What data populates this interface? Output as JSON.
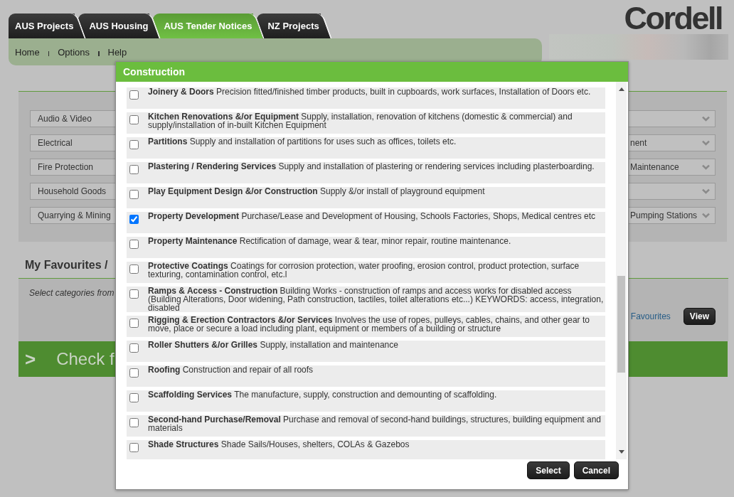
{
  "header": {
    "tabs": [
      {
        "label": "AUS Projects",
        "selected": false
      },
      {
        "label": "AUS Housing",
        "selected": false
      },
      {
        "label": "AUS Tender Notices",
        "selected": true
      },
      {
        "label": "NZ Projects",
        "selected": false
      }
    ],
    "logo": "Cordell"
  },
  "nav": {
    "links": [
      "Home",
      "Options",
      "Help"
    ]
  },
  "category_dropdowns": [
    {
      "left": "Audio & Video"
    },
    {
      "left": "Electrical",
      "right": "nent"
    },
    {
      "left": "Fire Protection",
      "right": "Maintenance"
    },
    {
      "left": "Household Goods"
    },
    {
      "left": "Quarrying & Mining",
      "right": "Pumping Stations"
    }
  ],
  "favourites": {
    "title": "My Favourites /",
    "hint": "Select categories from",
    "link": "Favourites",
    "button": "View"
  },
  "banner": {
    "arrow": ">",
    "text": "Check f"
  },
  "dialog": {
    "title": "Construction",
    "items": [
      {
        "name": "Joinery & Doors",
        "description": "Precision fitted/finished timber products, built in cupboards, work surfaces, Installation of Doors etc.",
        "checked": false
      },
      {
        "name": "Kitchen Renovations &/or Equipment",
        "description": "Supply, installation, renovation of kitchens (domestic & commercial) and supply/installation of in-built Kitchen Equipment",
        "checked": false
      },
      {
        "name": "Partitions",
        "description": "Supply and installation of partitions for uses such as offices, toilets etc.",
        "checked": false
      },
      {
        "name": "Plastering / Rendering Services",
        "description": "Supply and installation of plastering or rendering services including plasterboarding.",
        "checked": false
      },
      {
        "name": "Play Equipment Design &/or Construction",
        "description": "Supply &/or install of playground equipment",
        "checked": false
      },
      {
        "name": "Property Development",
        "description": "Purchase/Lease and Development of Housing, Schools Factories, Shops, Medical centres etc",
        "checked": true
      },
      {
        "name": "Property Maintenance",
        "description": "Rectification of damage, wear & tear, minor repair, routine maintenance.",
        "checked": false
      },
      {
        "name": "Protective Coatings",
        "description": "Coatings for corrosion protection, water proofing, erosion control, product protection, surface texturing, contamination control, etc.l",
        "checked": false
      },
      {
        "name": "Ramps & Access - Construction",
        "description": "Building Works - construction of ramps and access works for disabled access (Building Alterations, Door widening, Path construction, tactiles, toilet alterations etc...) KEYWORDS: access, integration, disabled",
        "checked": false
      },
      {
        "name": "Rigging & Erection Contractors &/or Services",
        "description": "Involves the use of ropes, pulleys, cables, chains, and other gear to move, place or secure a load including plant, equipment or members of a building or structure",
        "checked": false
      },
      {
        "name": "Roller Shutters &/or Grilles",
        "description": "Supply, installation and maintenance",
        "checked": false
      },
      {
        "name": "Roofing",
        "description": "Construction and repair of all roofs",
        "checked": false
      },
      {
        "name": "Scaffolding Services",
        "description": "The manufacture, supply, construction and demounting of scaffolding.",
        "checked": false
      },
      {
        "name": "Second-hand Purchase/Removal",
        "description": "Purchase and removal of second-hand buildings, structures, building equipment and materials",
        "checked": false
      },
      {
        "name": "Shade Structures",
        "description": "Shade Sails/Houses, shelters, COLAs & Gazebos",
        "checked": false
      }
    ],
    "buttons": [
      "Select",
      "Cancel"
    ]
  }
}
